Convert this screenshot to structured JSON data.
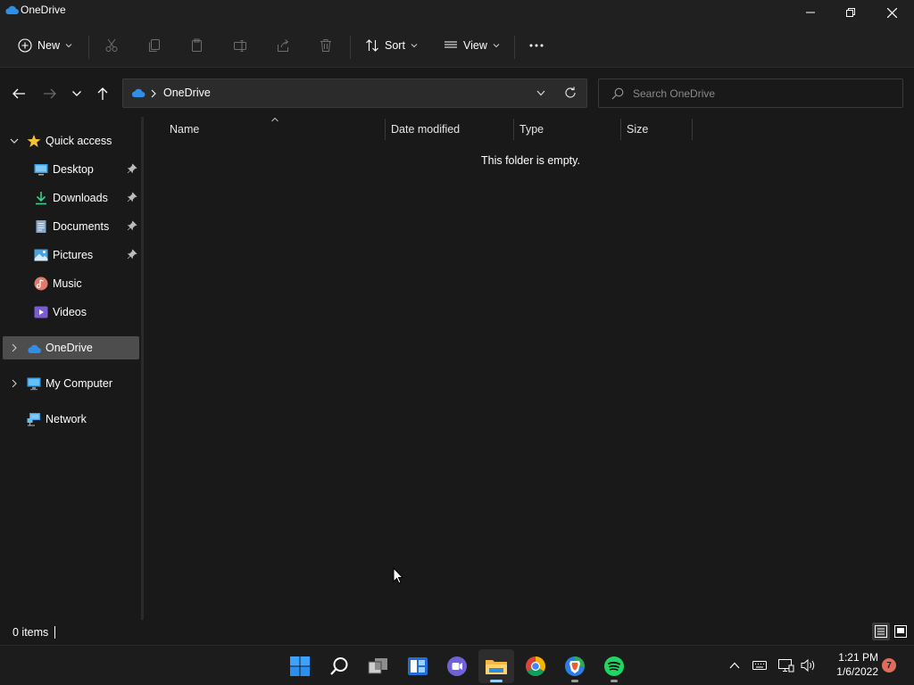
{
  "window": {
    "title": "OneDrive"
  },
  "toolbar": {
    "new_label": "New",
    "sort_label": "Sort",
    "view_label": "View"
  },
  "address": {
    "crumb": "OneDrive"
  },
  "search": {
    "placeholder": "Search OneDrive"
  },
  "sidebar": {
    "items": [
      {
        "label": "Quick access"
      },
      {
        "label": "Desktop"
      },
      {
        "label": "Downloads"
      },
      {
        "label": "Documents"
      },
      {
        "label": "Pictures"
      },
      {
        "label": "Music"
      },
      {
        "label": "Videos"
      },
      {
        "label": "OneDrive"
      },
      {
        "label": "My Computer"
      },
      {
        "label": "Network"
      }
    ]
  },
  "columns": [
    "Name",
    "Date modified",
    "Type",
    "Size"
  ],
  "content": {
    "empty_message": "This folder is empty."
  },
  "status": {
    "item_count": "0 items"
  },
  "taskbar": {
    "time": "1:21 PM",
    "date": "1/6/2022",
    "notification_count": "7"
  },
  "colors": {
    "accent": "#4cc2ff",
    "selected": "#4d4d4d",
    "background": "#191919",
    "chrome": "#202020"
  }
}
